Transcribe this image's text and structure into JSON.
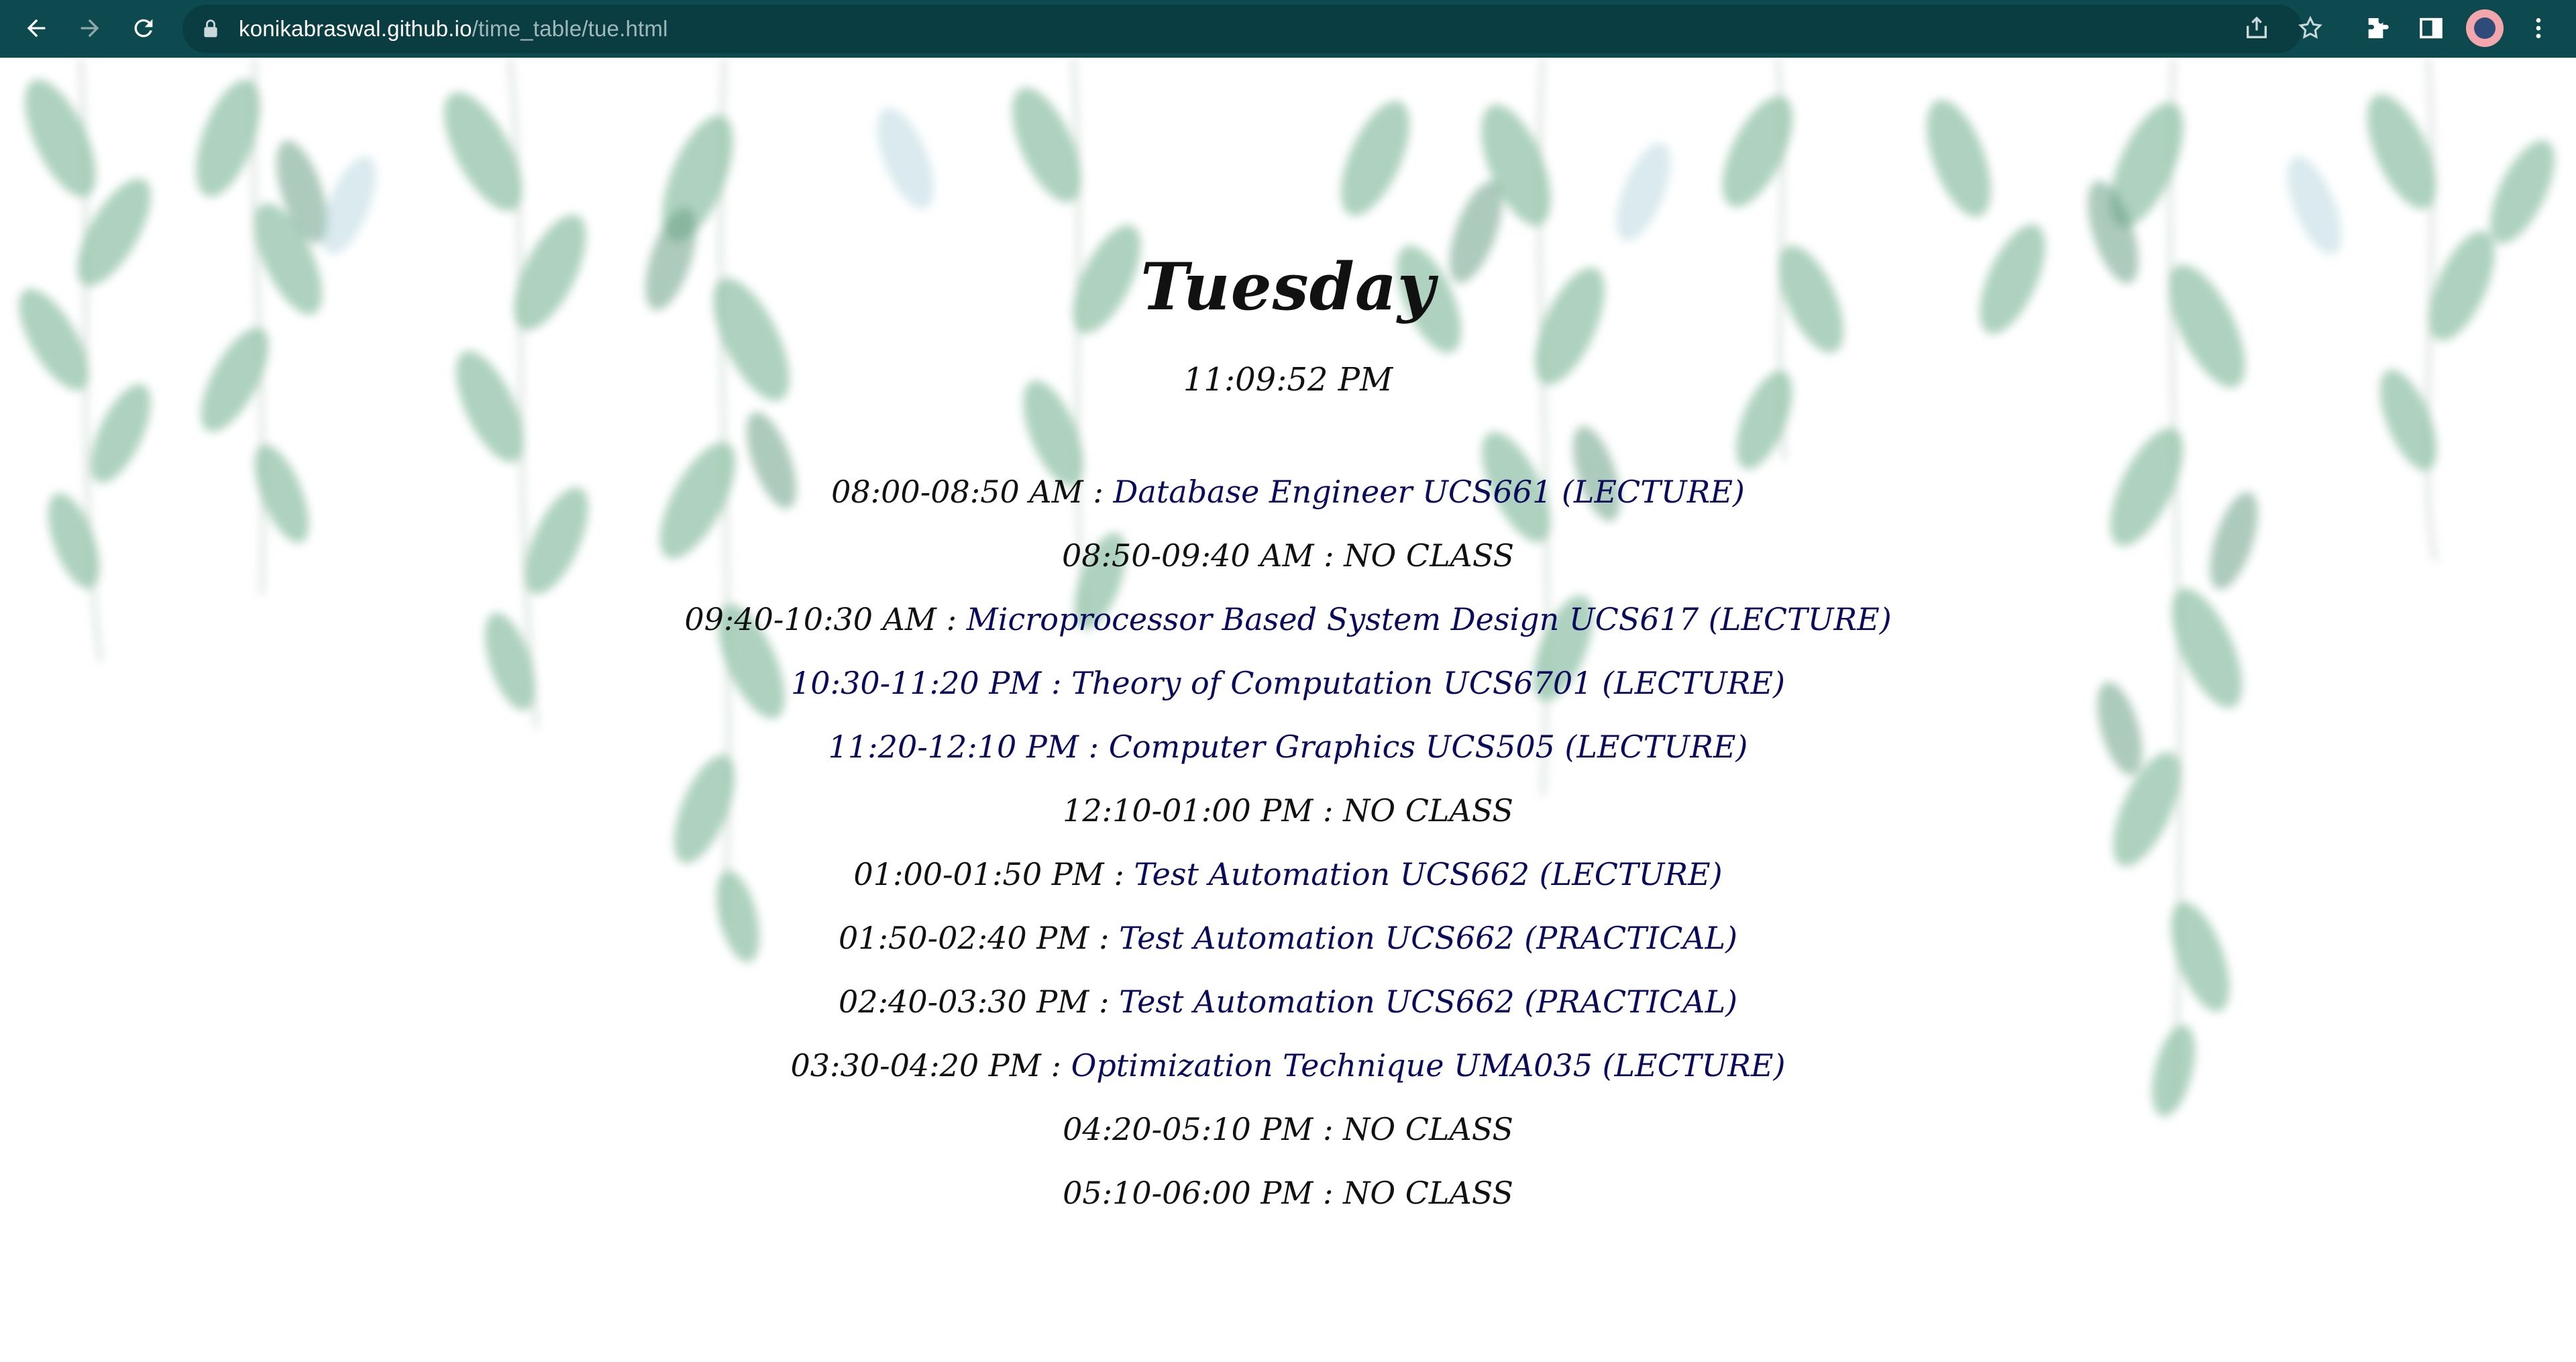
{
  "browser": {
    "url_host": "konikabraswal.github.io",
    "url_path": "/time_table/tue.html",
    "icons": [
      "back-icon",
      "forward-icon",
      "reload-icon",
      "lock-icon",
      "share-icon",
      "star-icon",
      "extensions-icon",
      "side-panel-icon",
      "profile-avatar",
      "menu-icon"
    ]
  },
  "page": {
    "day": "Tuesday",
    "clock": "11:09:52 PM",
    "schedule": [
      {
        "time": "08:00-08:50 AM : ",
        "course": "Database Engineer UCS661 (LECTURE)"
      },
      {
        "time": "08:50-09:40 AM : ",
        "course": "NO CLASS"
      },
      {
        "time": "09:40-10:30 AM : ",
        "course": "Microprocessor Based System Design UCS617 (LECTURE)"
      },
      {
        "time": "10:30-11:20 PM : ",
        "course": "Theory of Computation UCS6701 (LECTURE)"
      },
      {
        "time": "11:20-12:10 PM : ",
        "course": "Computer Graphics UCS505 (LECTURE)"
      },
      {
        "time": "12:10-01:00 PM : ",
        "course": "NO CLASS"
      },
      {
        "time": "01:00-01:50 PM : ",
        "course": "Test Automation UCS662 (LECTURE)"
      },
      {
        "time": "01:50-02:40 PM : ",
        "course": "Test Automation UCS662 (PRACTICAL)"
      },
      {
        "time": "02:40-03:30 PM : ",
        "course": "Test Automation UCS662 (PRACTICAL)"
      },
      {
        "time": "03:30-04:20 PM : ",
        "course": "Optimization Technique UMA035 (LECTURE)"
      },
      {
        "time": "04:20-05:10 PM : ",
        "course": "NO CLASS"
      },
      {
        "time": "05:10-06:00 PM : ",
        "course": "NO CLASS"
      }
    ]
  },
  "colors": {
    "toolbar": "#0c4a4f",
    "course_text": "#0b0b5c",
    "time_text": "#111111"
  }
}
